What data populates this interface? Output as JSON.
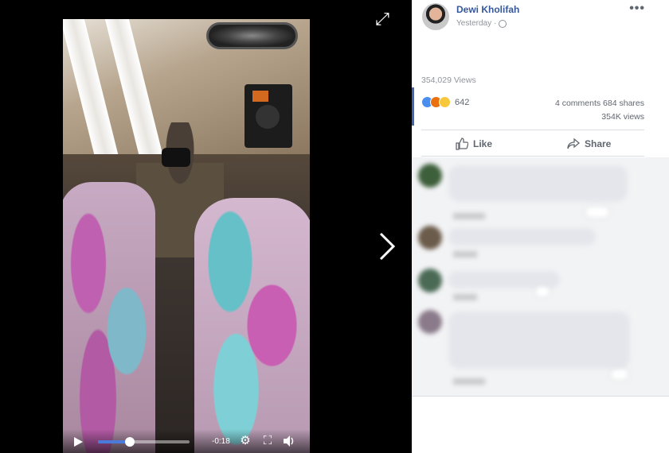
{
  "post": {
    "author": "Dewi Kholifah",
    "timestamp": "Yesterday",
    "privacy_icon": "globe-icon",
    "more_label": "•••",
    "views": "354,029 Views",
    "reaction_count": "642",
    "comments": "4 comments",
    "shares": "684 shares",
    "views_short": "354K views",
    "like_label": "Like",
    "share_label": "Share"
  },
  "video": {
    "time_remaining": "-0:18",
    "progress": 0.35,
    "accent": "#4b7bd8"
  },
  "colors": {
    "link": "#365899",
    "like": "#4a8ef0",
    "angry": "#e9710f",
    "haha": "#f7c83b"
  }
}
